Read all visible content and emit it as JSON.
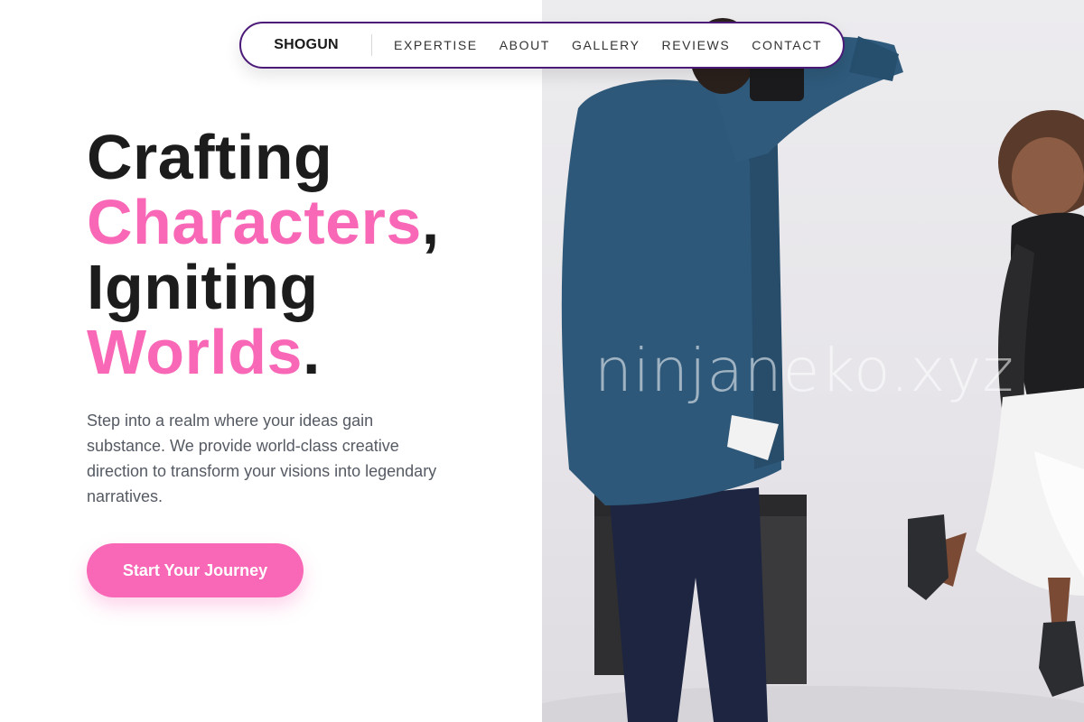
{
  "nav": {
    "brand": "SHOGUN",
    "links": [
      "EXPERTISE",
      "ABOUT",
      "GALLERY",
      "REVIEWS",
      "CONTACT"
    ]
  },
  "hero": {
    "headline": {
      "line1": "Crafting",
      "line2_accent": "Characters",
      "line2_punct": ",",
      "line3": "Igniting",
      "line4_accent": "Worlds",
      "line4_punct": "."
    },
    "intro": "Step into a realm where your ideas gain substance. We provide world-class creative direction to transform your visions into legendary narratives.",
    "cta_label": "Start Your Journey",
    "watermark": "ninjaneko.xyz"
  },
  "colors": {
    "accent": "#f868b6",
    "nav_border": "#4b1a78",
    "headline": "#1c1c1c",
    "body_text": "#555a63"
  }
}
